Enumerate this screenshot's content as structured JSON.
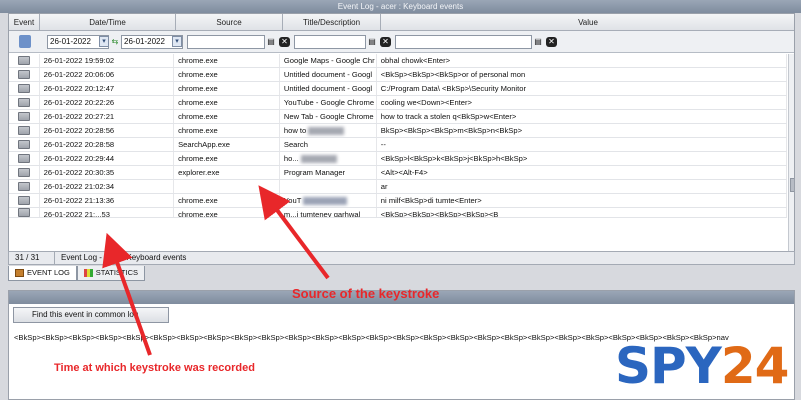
{
  "window": {
    "title": "Event Log - acer : Keyboard events"
  },
  "grid": {
    "columns": [
      "Event",
      "Date/Time",
      "Source",
      "Title/Description",
      "Value"
    ],
    "filter": {
      "date_from": "26-01-2022",
      "date_to": "26-01-2022",
      "source": "",
      "title": "",
      "value": ""
    },
    "rows": [
      {
        "datetime": "26-01-2022 19:59:02",
        "source": "chrome.exe",
        "title": "Google Maps - Google Chr",
        "value": "obhal chowk<Enter>"
      },
      {
        "datetime": "26-01-2022 20:06:06",
        "source": "chrome.exe",
        "title": "Untitled document - Googl",
        "value": "<BkSp><BkSp><BkSp>or of personal mon"
      },
      {
        "datetime": "26-01-2022 20:12:47",
        "source": "chrome.exe",
        "title": "Untitled document - Googl",
        "value": "C:/Program Data\\ <BkSp>\\Security Monitor"
      },
      {
        "datetime": "26-01-2022 20:22:26",
        "source": "chrome.exe",
        "title": "YouTube - Google Chrome",
        "value": "cooling we<Down><Enter>"
      },
      {
        "datetime": "26-01-2022 20:27:21",
        "source": "chrome.exe",
        "title": "New Tab - Google Chrome",
        "value": "how to track a stolen q<BkSp>w<Enter>"
      },
      {
        "datetime": "26-01-2022 20:28:56",
        "source": "chrome.exe",
        "title": "how to",
        "title_blur": true,
        "value": "BkSp><BkSp><BkSp>m<BkSp>n<BkSp>"
      },
      {
        "datetime": "26-01-2022 20:28:58",
        "source": "SearchApp.exe",
        "title": "Search",
        "value": "--"
      },
      {
        "datetime": "26-01-2022 20:29:44",
        "source": "chrome.exe",
        "title": "ho...",
        "title_blur": true,
        "value": "<BkSp>l<BkSp>k<BkSp>j<BkSp>h<BkSp>"
      },
      {
        "datetime": "26-01-2022 20:30:35",
        "source": "explorer.exe",
        "title": "Program Manager",
        "value": "<Alt><Alt-F4>"
      },
      {
        "datetime": "26-01-2022 21:02:34",
        "source": "",
        "title": "",
        "value": "ar"
      },
      {
        "datetime": "26-01-2022 21:13:36",
        "source": "chrome.exe",
        "title": "YouT",
        "title_blur": true,
        "value": "ni milf<BkSp>di tumte<Enter>"
      },
      {
        "datetime": "26-01-2022 21:...53",
        "source": "chrome.exe",
        "title": "m...i tumteney garhwal",
        "value": "<BkSp><BkSp><BkSp><BkSp><B"
      }
    ]
  },
  "statusbar": {
    "count": "31 / 31",
    "text": "Event Log - acer : Keyboard events"
  },
  "tabs": [
    {
      "label": "EVENT LOG",
      "active": true
    },
    {
      "label": "STATISTICS",
      "active": false
    }
  ],
  "details": {
    "find_button": "Find this event in common log",
    "value_text": "<BkSp><BkSp><BkSp><BkSp><BkSp><BkSp><BkSp><BkSp><BkSp><BkSp><BkSp><BkSp><BkSp><BkSp><BkSp><BkSp><BkSp><BkSp><BkSp><BkSp><BkSp><BkSp><BkSp><BkSp><BkSp><BkSp>nav"
  },
  "annotations": {
    "source_label": "Source of the keystroke",
    "time_label": "Time at which keystroke was recorded",
    "color": "#e8272a"
  },
  "logo": {
    "spy": "SPY",
    "num": "24",
    "spy_color": "#2b66bf",
    "num_color": "#e06a16"
  }
}
